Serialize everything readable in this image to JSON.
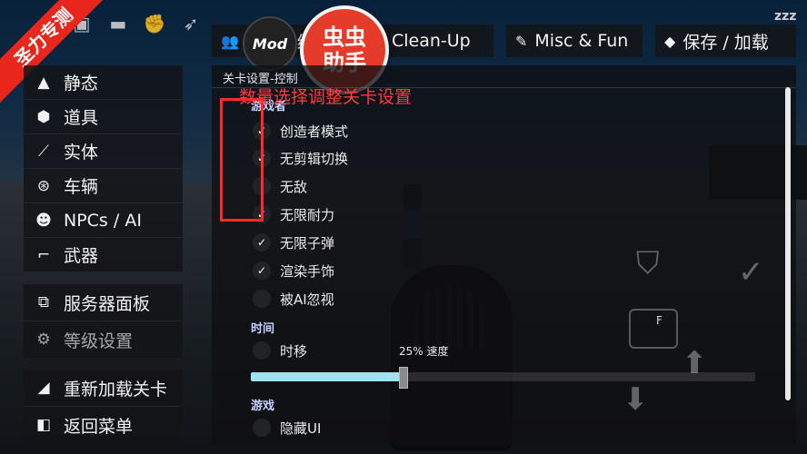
{
  "ribbon": {
    "text": "圣力专测"
  },
  "logo": {
    "line1": "虫虫",
    "line2": "助手"
  },
  "mod_badge": {
    "text": "Mod"
  },
  "top_bar": {
    "icons": [
      "briefcase-icon",
      "chat-icon",
      "fist-icon",
      "rocket-icon"
    ],
    "sleep_text": "zzz"
  },
  "tabs": [
    {
      "label": "编",
      "icon": "user-group-icon"
    },
    {
      "label": "Clean-Up",
      "icon": ""
    },
    {
      "label": "Misc & Fun",
      "icon": "feather-icon"
    },
    {
      "label": "保存 / 加载",
      "icon": "cube-icon"
    }
  ],
  "menu": {
    "primary": [
      {
        "label": "静态",
        "icon": "mountain-icon"
      },
      {
        "label": "道具",
        "icon": "box-icon"
      },
      {
        "label": "实体",
        "icon": "wand-icon"
      },
      {
        "label": "车辆",
        "icon": "steering-wheel-icon"
      },
      {
        "label": "NPCs / AI",
        "icon": "npc-icon"
      },
      {
        "label": "武器",
        "icon": "rifle-icon"
      }
    ],
    "server": [
      {
        "label": "服务器面板",
        "icon": "network-icon"
      },
      {
        "label": "等级设置",
        "icon": "gear-icon"
      }
    ],
    "actions": [
      {
        "label": "重新加载关卡",
        "icon": "eraser-icon"
      },
      {
        "label": "返回菜单",
        "icon": "exit-door-icon"
      }
    ]
  },
  "panel": {
    "title": "关卡设置-控制",
    "sections": {
      "players": "游戏者",
      "time": "时间",
      "game": "游戏"
    },
    "player_options": [
      {
        "label": "创造者模式",
        "checked": true
      },
      {
        "label": "无剪辑切换",
        "checked": true
      },
      {
        "label": "无敌",
        "checked": false
      },
      {
        "label": "无限耐力",
        "checked": true
      },
      {
        "label": "无限子弹",
        "checked": true
      },
      {
        "label": "渲染手饰",
        "checked": true
      },
      {
        "label": "被AI忽视",
        "checked": false
      }
    ],
    "time_option": {
      "label": "时移",
      "checked": false
    },
    "speed_text": "25% 速度",
    "speed_fraction": 0.3,
    "game_option": {
      "label": "隐藏UI",
      "checked": false
    },
    "check_mark": "✓"
  },
  "annotation": {
    "text": "数量选择调整关卡设置",
    "color": "#ff3b3b"
  },
  "side_controls": {
    "fire_key": "F"
  }
}
